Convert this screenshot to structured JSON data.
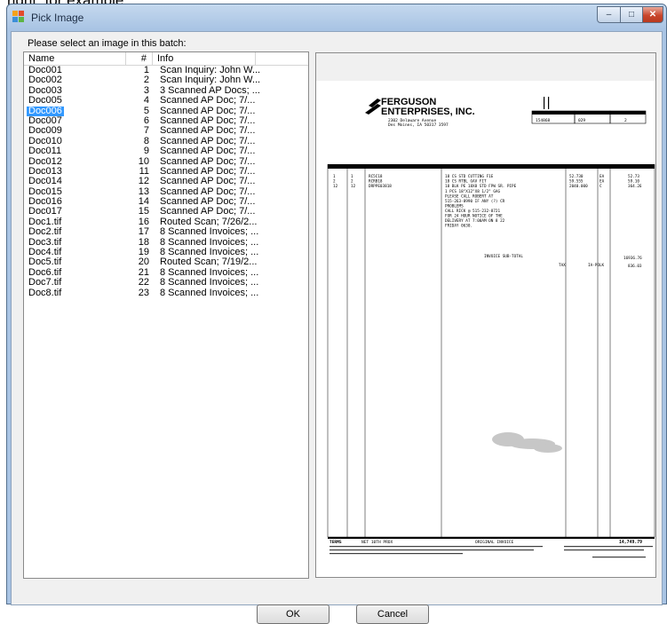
{
  "background_text": "right, for example:",
  "window": {
    "title": "Pick Image",
    "minimize_glyph": "–",
    "maximize_glyph": "□",
    "close_glyph": "✕"
  },
  "prompt": "Please select an image in this batch:",
  "columns": {
    "name": "Name",
    "num": "#",
    "info": "Info"
  },
  "rows": [
    {
      "name": "Doc001",
      "num": "1",
      "info": "Scan Inquiry: John W..."
    },
    {
      "name": "Doc002",
      "num": "2",
      "info": "Scan Inquiry: John W..."
    },
    {
      "name": "Doc003",
      "num": "3",
      "info": "3 Scanned AP Docs; ..."
    },
    {
      "name": "Doc005",
      "num": "4",
      "info": "Scanned AP Doc; 7/..."
    },
    {
      "name": "Doc006",
      "num": "5",
      "info": "Scanned AP Doc; 7/...",
      "selected": true
    },
    {
      "name": "Doc007",
      "num": "6",
      "info": "Scanned AP Doc; 7/..."
    },
    {
      "name": "Doc009",
      "num": "7",
      "info": "Scanned AP Doc; 7/..."
    },
    {
      "name": "Doc010",
      "num": "8",
      "info": "Scanned AP Doc; 7/..."
    },
    {
      "name": "Doc011",
      "num": "9",
      "info": "Scanned AP Doc; 7/..."
    },
    {
      "name": "Doc012",
      "num": "10",
      "info": "Scanned AP Doc; 7/..."
    },
    {
      "name": "Doc013",
      "num": "11",
      "info": "Scanned AP Doc; 7/..."
    },
    {
      "name": "Doc014",
      "num": "12",
      "info": "Scanned AP Doc; 7/..."
    },
    {
      "name": "Doc015",
      "num": "13",
      "info": "Scanned AP Doc; 7/..."
    },
    {
      "name": "Doc016",
      "num": "14",
      "info": "Scanned AP Doc; 7/..."
    },
    {
      "name": "Doc017",
      "num": "15",
      "info": "Scanned AP Doc; 7/..."
    },
    {
      "name": "Doc1.tif",
      "num": "16",
      "info": "Routed Scan; 7/26/2..."
    },
    {
      "name": "Doc2.tif",
      "num": "17",
      "info": "8 Scanned Invoices; ..."
    },
    {
      "name": "Doc3.tif",
      "num": "18",
      "info": "8 Scanned Invoices; ..."
    },
    {
      "name": "Doc4.tif",
      "num": "19",
      "info": "8 Scanned Invoices; ..."
    },
    {
      "name": "Doc5.tif",
      "num": "20",
      "info": "Routed Scan; 7/19/2..."
    },
    {
      "name": "Doc6.tif",
      "num": "21",
      "info": "8 Scanned Invoices; ..."
    },
    {
      "name": "Doc7.tif",
      "num": "22",
      "info": "8 Scanned Invoices; ..."
    },
    {
      "name": "Doc8.tif",
      "num": "23",
      "info": "8 Scanned Invoices; ..."
    }
  ],
  "preview": {
    "company_line1": "FERGUSON",
    "company_line2": "ENTERPRISES, INC.",
    "address_line1": "2302 Delaware Avenue",
    "address_line2": "Des Moines, IA 50317 3597",
    "header_invoice_no": "154868",
    "header_customer": "029",
    "header_page": "2",
    "line_items": [
      {
        "ord": "1",
        "ship": "1",
        "part": "RC5C18",
        "desc": "18 CS STD CUTTING F1E",
        "price": "52.730",
        "um": "EA",
        "amount": "52.73"
      },
      {
        "ord": "2",
        "ship": "2",
        "part": "RCRB18",
        "desc": "18 CS RTBL GAV FIT",
        "price": "59.555",
        "um": "EA",
        "amount": "59.10"
      },
      {
        "ord": "12",
        "ship": "12",
        "part": "DRPPE03818",
        "desc": "18 BLK PE 18X8 STD FPW SR. PIPE",
        "price": "2040.000",
        "um": "C",
        "amount": "364.26"
      }
    ],
    "desc_extra": [
      "1 PCS 18\"X12\"X8 1/2\" GAG",
      "PLEASE CALL ROBERT AT",
      "515-263-8990 IF ANY (?) CR",
      "PROBLEMS",
      "CALL RICK @ 515-232-8721",
      "FOR 24 HOUR NOTICE OF THE",
      "DELIVERY AT 7:00AM ON 8 22",
      "FRIDAY 0630."
    ],
    "subtotal_label": "INVOICE SUB-TOTAL",
    "subtotal_value": "16936.76",
    "tax_label": "TAX",
    "tax_code": "IA-POLK",
    "tax_value": "836.03",
    "footer_terms": "TERMS",
    "footer_terms_value": "NET 10TH PROX",
    "footer_original": "ORIGINAL INVOICE",
    "footer_total": "14,749.79"
  },
  "buttons": {
    "ok": "OK",
    "cancel": "Cancel"
  }
}
